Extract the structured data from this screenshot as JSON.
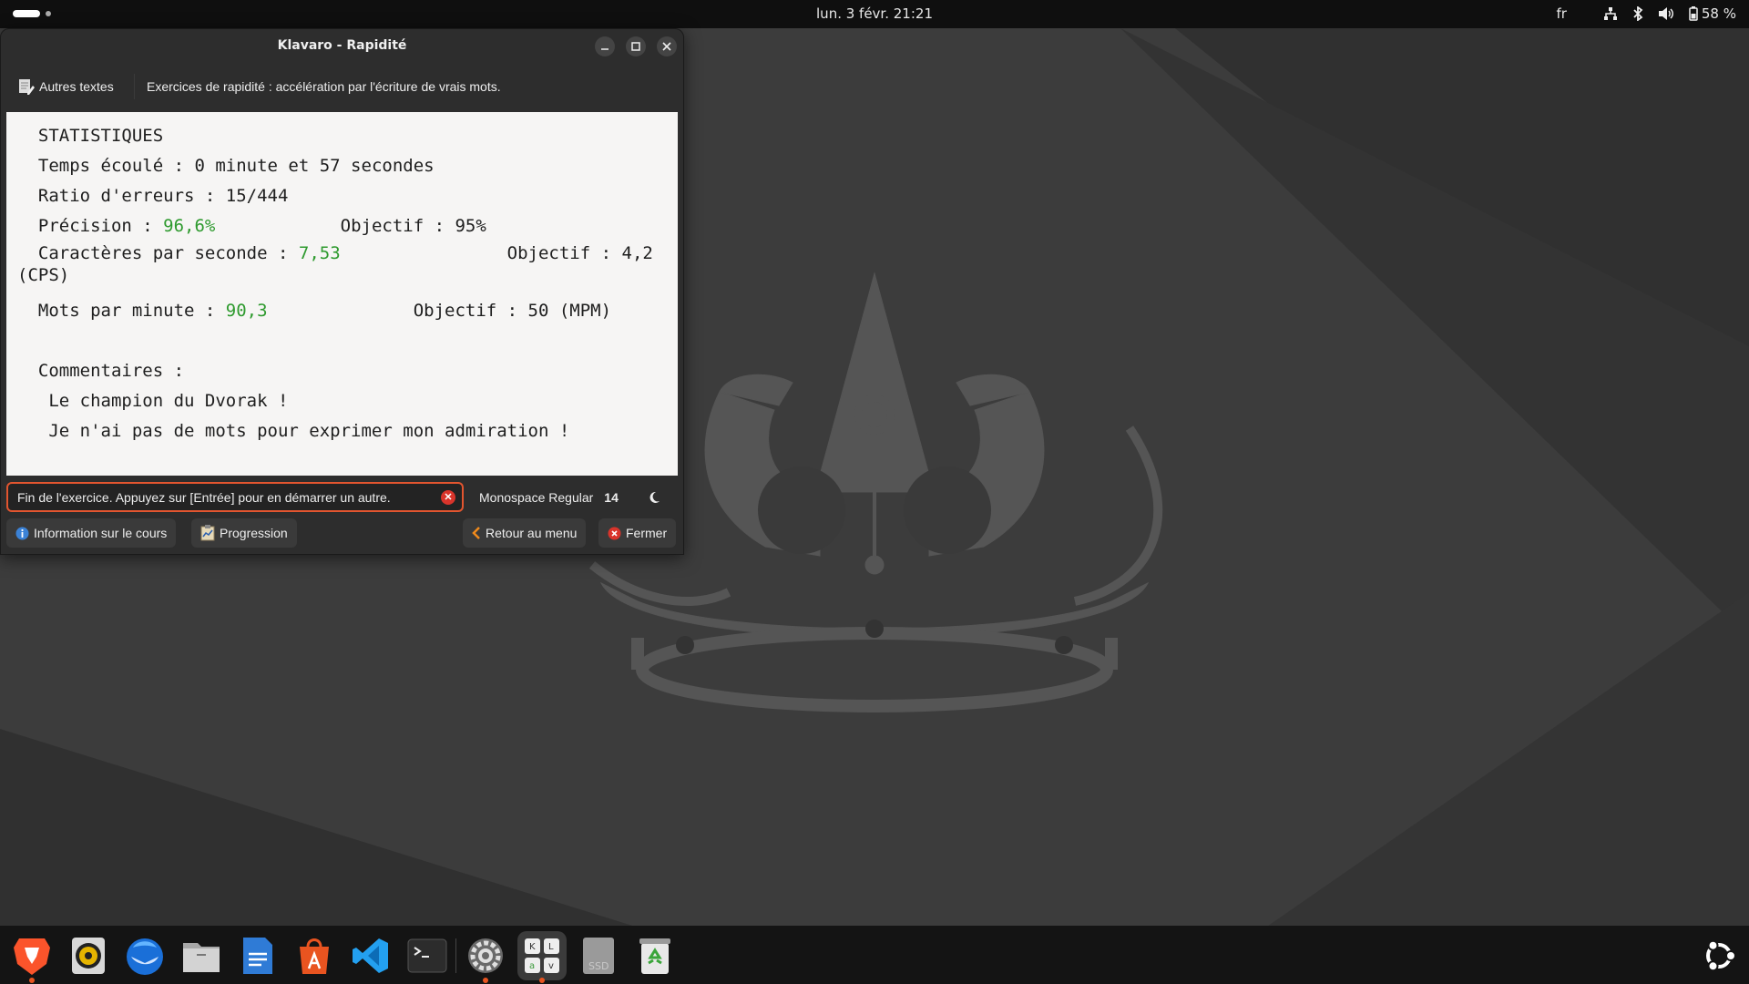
{
  "topbar": {
    "clock": "lun. 3 févr.  21:21",
    "language": "fr",
    "battery": "58 %"
  },
  "window": {
    "title": "Klavaro - Rapidité",
    "toolbar": {
      "other_texts_label": "Autres textes",
      "description": "Exercices de rapidité : accélération par l'écriture de vrais mots."
    },
    "stats": {
      "heading": "STATISTIQUES",
      "elapsed_label": "Temps écoulé : 0 minute et 57 secondes",
      "error_ratio_label": "Ratio d'erreurs : 15/444",
      "precision_label": "Précision : ",
      "precision_value": "96,6%",
      "precision_goal": "Objectif : 95%",
      "cps_label": "Caractères par seconde : ",
      "cps_value": "7,53",
      "cps_goal": "Objectif : 4,2",
      "cps_unit": "(CPS)",
      "wpm_label": "Mots par minute : ",
      "wpm_value": "90,3",
      "wpm_goal": "Objectif : 50 (MPM)",
      "comments_label": "Commentaires :",
      "comment_1": "Le champion du Dvorak !",
      "comment_2": "Je n'ai pas de mots pour exprimer mon admiration !"
    },
    "status_entry": "Fin de l'exercice. Appuyez sur [Entrée] pour en démarrer un autre.",
    "font": {
      "name": "Monospace Regular",
      "size": "14"
    },
    "buttons": {
      "course_info": "Information sur le cours",
      "progression": "Progression",
      "back_to_menu": "Retour au menu",
      "close": "Fermer"
    }
  },
  "dock": {
    "items": [
      "brave-browser",
      "rhythmbox",
      "thunderbird",
      "files",
      "libreoffice-writer",
      "app-center",
      "vscode",
      "terminal",
      "settings",
      "klavaro",
      "ssd-drive",
      "trash"
    ],
    "ssd_label": "SSD"
  },
  "colors": {
    "accent": "#e95420",
    "success_green": "#2e9a2e",
    "entry_border": "#e2552f"
  }
}
